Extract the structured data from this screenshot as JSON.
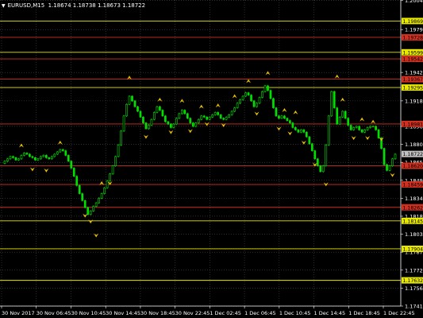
{
  "title": {
    "symbol": "EURUSD,M15",
    "ohlc": "1.18674 1.18738 1.18673 1.18722"
  },
  "colors": {
    "background": "#000000",
    "grid": "#4a4a4a",
    "candle": "#00e000",
    "axis_text": "#ffffff",
    "yellow_line": "#e8e800",
    "red_line": "#d03020",
    "arrow": "#e8c000",
    "current_price_bg": "#c0c0c0"
  },
  "chart_data": {
    "type": "candlestick",
    "symbol": "EURUSD",
    "timeframe": "M15",
    "ylim": [
      1.1741,
      1.2005
    ],
    "y_ticks": [
      "1.20045",
      "1.19795",
      "1.19425",
      "1.19180",
      "1.18960",
      "1.18805",
      "1.18650",
      "1.18495",
      "1.18340",
      "1.18185",
      "1.18030",
      "1.17875",
      "1.17720",
      "1.17565",
      "1.17410"
    ],
    "x_ticks": [
      "30 Nov 2017",
      "30 Nov 06:45",
      "30 Nov 10:45",
      "30 Nov 14:45",
      "30 Nov 18:45",
      "30 Nov 22:45",
      "1 Dec 02:45",
      "1 Dec 06:45",
      "1 Dec 10:45",
      "1 Dec 14:45",
      "1 Dec 18:45",
      "1 Dec 22:45"
    ],
    "current_price": "1.18722",
    "horizontal_levels": [
      {
        "price": 1.19869,
        "label": "1.19869",
        "color": "yellow"
      },
      {
        "price": 1.19728,
        "label": "1.19728",
        "color": "red"
      },
      {
        "price": 1.19599,
        "label": "1.19599",
        "color": "yellow"
      },
      {
        "price": 1.19542,
        "label": "1.19542",
        "color": "red"
      },
      {
        "price": 1.19367,
        "label": "1.19367",
        "color": "red"
      },
      {
        "price": 1.19295,
        "label": "1.19295",
        "color": "yellow"
      },
      {
        "price": 1.18981,
        "label": "1.18981",
        "color": "red"
      },
      {
        "price": 1.1862,
        "label": "1.18620",
        "color": "red"
      },
      {
        "price": 1.18459,
        "label": "1.18459",
        "color": "red"
      },
      {
        "price": 1.18262,
        "label": "1.18262",
        "color": "red"
      },
      {
        "price": 1.18145,
        "label": "1.18145",
        "color": "yellow"
      },
      {
        "price": 1.17904,
        "label": "1.17904",
        "color": "yellow"
      },
      {
        "price": 1.17632,
        "label": "1.17632",
        "color": "yellow"
      }
    ],
    "close_series": [
      1.1866,
      1.1868,
      1.187,
      1.1869,
      1.1867,
      1.1868,
      1.1871,
      1.1873,
      1.1872,
      1.187,
      1.1869,
      1.1867,
      1.1868,
      1.187,
      1.1871,
      1.1869,
      1.1868,
      1.187,
      1.1872,
      1.1874,
      1.1876,
      1.1875,
      1.1871,
      1.1866,
      1.186,
      1.1853,
      1.1845,
      1.1838,
      1.1832,
      1.1826,
      1.182,
      1.1823,
      1.1827,
      1.183,
      1.1834,
      1.1838,
      1.1843,
      1.1849,
      1.1855,
      1.1862,
      1.187,
      1.188,
      1.1892,
      1.1905,
      1.1915,
      1.1922,
      1.1918,
      1.1913,
      1.1909,
      1.1904,
      1.1899,
      1.1894,
      1.1897,
      1.1902,
      1.1908,
      1.1913,
      1.191,
      1.1905,
      1.19,
      1.1898,
      1.1895,
      1.1898,
      1.1903,
      1.1907,
      1.191,
      1.1907,
      1.1903,
      1.1899,
      1.1896,
      1.1899,
      1.1902,
      1.1905,
      1.1904,
      1.1902,
      1.1904,
      1.1906,
      1.1908,
      1.1906,
      1.1903,
      1.1902,
      1.1904,
      1.1906,
      1.1909,
      1.1912,
      1.1916,
      1.1919,
      1.1922,
      1.1925,
      1.1923,
      1.1918,
      1.1913,
      1.1916,
      1.1921,
      1.1926,
      1.1931,
      1.1927,
      1.192,
      1.1912,
      1.1905,
      1.1903,
      1.1905,
      1.1903,
      1.1901,
      1.1899,
      1.1895,
      1.1893,
      1.1891,
      1.1893,
      1.1891,
      1.1887,
      1.1881,
      1.1875,
      1.1868,
      1.1862,
      1.1857,
      1.1862,
      1.188,
      1.1905,
      1.1926,
      1.1912,
      1.1898,
      1.1904,
      1.1909,
      1.1903,
      1.1897,
      1.1893,
      1.1895,
      1.1896,
      1.1893,
      1.1891,
      1.1893,
      1.1895,
      1.1896,
      1.1896,
      1.1893,
      1.1886,
      1.1877,
      1.1863,
      1.1858,
      1.1862,
      1.1868,
      1.1872
    ],
    "arrow_markers": [
      {
        "dir": "up",
        "i": 6,
        "price": 1.18785
      },
      {
        "dir": "up",
        "i": 20,
        "price": 1.1881
      },
      {
        "dir": "down",
        "i": 10,
        "price": 1.186
      },
      {
        "dir": "down",
        "i": 15,
        "price": 1.1859
      },
      {
        "dir": "down",
        "i": 29,
        "price": 1.182
      },
      {
        "dir": "down",
        "i": 31,
        "price": 1.1815
      },
      {
        "dir": "down",
        "i": 33,
        "price": 1.1803
      },
      {
        "dir": "up",
        "i": 35,
        "price": 1.1846
      },
      {
        "dir": "down",
        "i": 38,
        "price": 1.1848
      },
      {
        "dir": "up",
        "i": 45,
        "price": 1.1937
      },
      {
        "dir": "down",
        "i": 51,
        "price": 1.1888
      },
      {
        "dir": "up",
        "i": 56,
        "price": 1.1918
      },
      {
        "dir": "down",
        "i": 60,
        "price": 1.1892
      },
      {
        "dir": "up",
        "i": 64,
        "price": 1.1917
      },
      {
        "dir": "down",
        "i": 67,
        "price": 1.1893
      },
      {
        "dir": "up",
        "i": 71,
        "price": 1.1912
      },
      {
        "dir": "down",
        "i": 73,
        "price": 1.1899
      },
      {
        "dir": "up",
        "i": 77,
        "price": 1.1913
      },
      {
        "dir": "down",
        "i": 79,
        "price": 1.1898
      },
      {
        "dir": "up",
        "i": 83,
        "price": 1.1921
      },
      {
        "dir": "up",
        "i": 88,
        "price": 1.1934
      },
      {
        "dir": "down",
        "i": 91,
        "price": 1.1908
      },
      {
        "dir": "up",
        "i": 95,
        "price": 1.1941
      },
      {
        "dir": "down",
        "i": 99,
        "price": 1.1895
      },
      {
        "dir": "up",
        "i": 101,
        "price": 1.1909
      },
      {
        "dir": "down",
        "i": 103,
        "price": 1.1891
      },
      {
        "dir": "up",
        "i": 105,
        "price": 1.1907
      },
      {
        "dir": "down",
        "i": 108,
        "price": 1.1883
      },
      {
        "dir": "down",
        "i": 112,
        "price": 1.1864
      },
      {
        "dir": "down",
        "i": 116,
        "price": 1.1847
      },
      {
        "dir": "up",
        "i": 120,
        "price": 1.1938
      },
      {
        "dir": "up",
        "i": 122,
        "price": 1.1918
      },
      {
        "dir": "down",
        "i": 126,
        "price": 1.1887
      },
      {
        "dir": "up",
        "i": 129,
        "price": 1.1901
      },
      {
        "dir": "down",
        "i": 131,
        "price": 1.1887
      },
      {
        "dir": "up",
        "i": 133,
        "price": 1.1899
      },
      {
        "dir": "down",
        "i": 136,
        "price": 1.1886
      },
      {
        "dir": "down",
        "i": 140,
        "price": 1.1855
      }
    ]
  }
}
